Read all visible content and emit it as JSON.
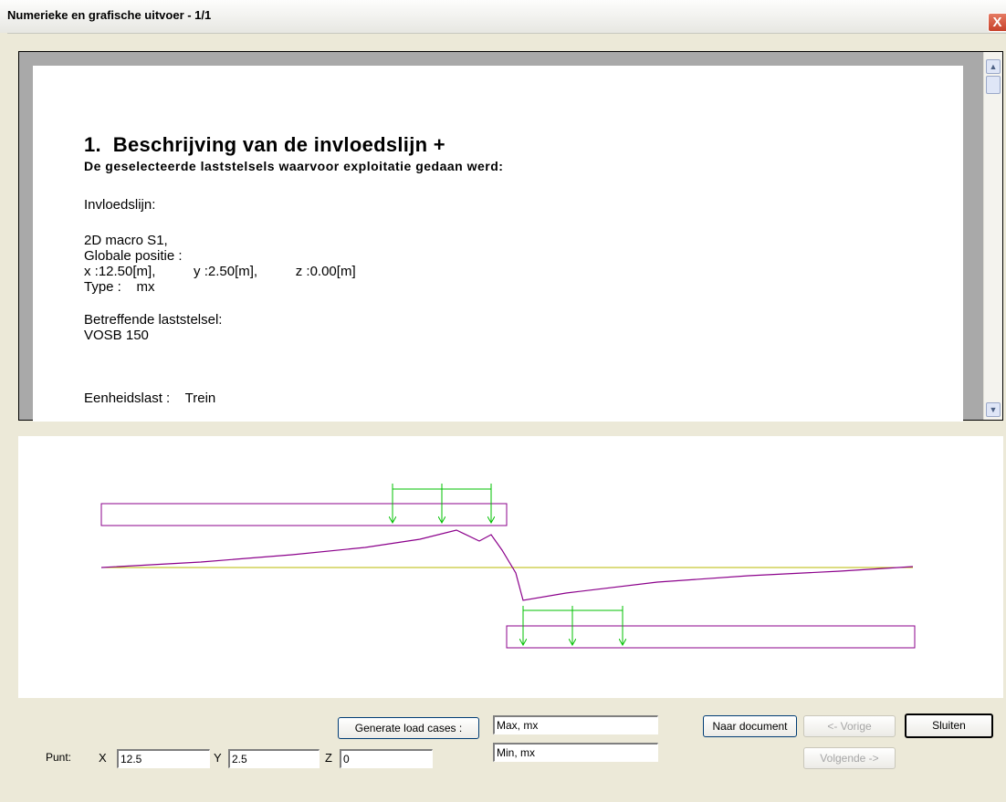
{
  "window": {
    "title": "Numerieke en grafische uitvoer - 1/1",
    "close_glyph": "X"
  },
  "document": {
    "heading": "1.  Beschrijving van de invloedslijn +",
    "subheading": "De geselecteerde laststelsels waarvoor exploitatie gedaan werd:",
    "lines": [
      "Invloedslijn:",
      "2D macro S1,",
      "Globale positie :",
      "x :12.50[m],          y :2.50[m],          z :0.00[m]",
      "Type :    mx",
      "Betreffende laststelsel:",
      "VOSB 150",
      "Eenheidslast :    Trein"
    ]
  },
  "scrollbar": {
    "up_icon": "chevron-up-icon",
    "down_icon": "chevron-down-icon"
  },
  "graph": {
    "colors": {
      "beam": "#8b008b",
      "influence_line": "#8b008b",
      "axis": "#b8b800",
      "load": "#00c000"
    }
  },
  "controls": {
    "generate_button": "Generate load cases :",
    "max_field": "Max, mx",
    "min_field": "Min, mx",
    "naar_document_button": "Naar document",
    "vorige_button": "<- Vorige",
    "volgende_button": "Volgende ->",
    "sluiten_button": "Sluiten",
    "punt_label": "Punt:",
    "x_label": "X",
    "x_value": "12.5",
    "y_label": "Y",
    "y_value": "2.5",
    "z_label": "Z",
    "z_value": "0"
  }
}
